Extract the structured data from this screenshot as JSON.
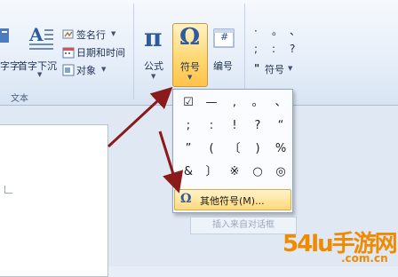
{
  "ribbon": {
    "left_cut_label": "字字",
    "dropcap_label": "首字下沉",
    "signature_label": "签名行",
    "datetime_label": "日期和时间",
    "object_label": "对象",
    "group_text_label": "文本",
    "formula_label": "公式",
    "formula_glyph": "π",
    "symbol_label": "符号",
    "symbol_glyph": "Ω",
    "number_label": "编号",
    "number_glyph": "#",
    "special_symbol_label": "符号",
    "special_punct": [
      "·",
      "。",
      "、",
      ";",
      ":",
      "?",
      "\""
    ]
  },
  "symbol_grid": [
    [
      "☑",
      "—",
      ",",
      "。",
      "、"
    ],
    [
      ";",
      ":",
      "!",
      "?",
      "“"
    ],
    [
      "”",
      "(",
      "〔",
      ")",
      "%"
    ],
    [
      "&",
      "〕",
      "※",
      "○",
      "◎"
    ]
  ],
  "more_symbols_label": "其他符号(M)...",
  "more_symbols_icon": "omega-icon",
  "tooltip_text": "插入来自对话框",
  "watermark_text": "54lu手游网",
  "watermark_url": ".com.cn",
  "colors": {
    "highlight": "#ffd873",
    "arrow": "#8b1a1a",
    "ribbon": "#dfe8f5"
  }
}
